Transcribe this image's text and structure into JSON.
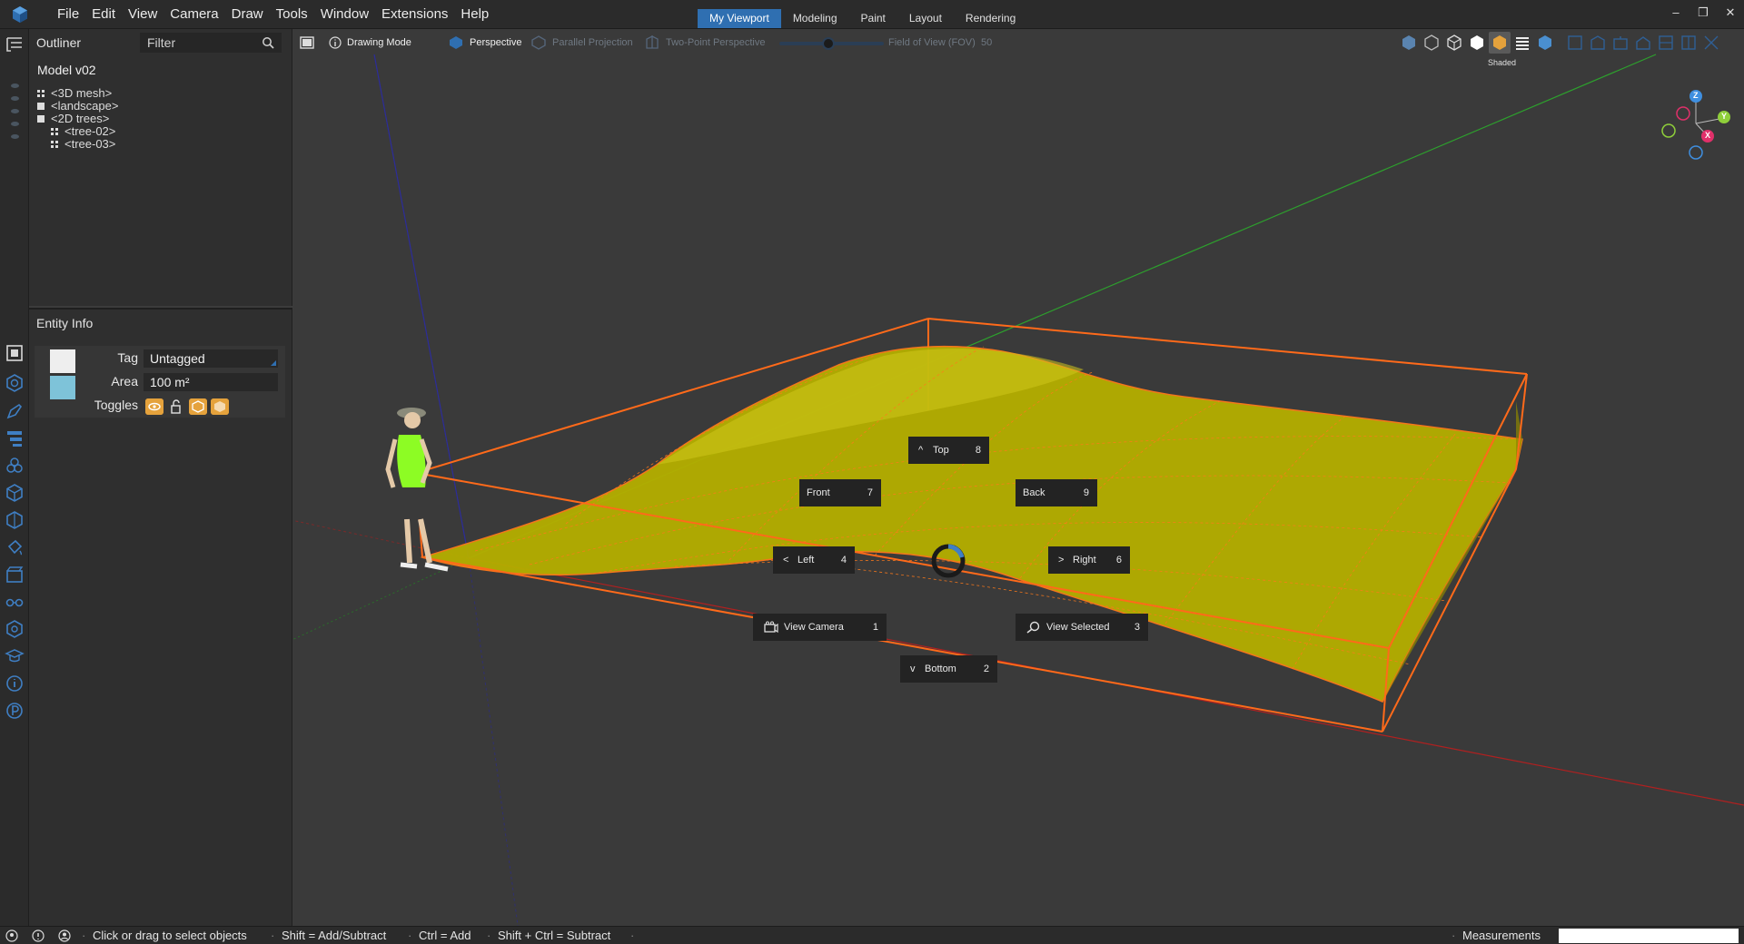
{
  "menubar": {
    "logo_icon": "app-cube-logo",
    "menus": [
      "File",
      "Edit",
      "View",
      "Camera",
      "Draw",
      "Tools",
      "Window",
      "Extensions",
      "Help"
    ],
    "mode_tabs": [
      {
        "label": "My Viewport",
        "active": true
      },
      {
        "label": "Modeling",
        "active": false
      },
      {
        "label": "Paint",
        "active": false
      },
      {
        "label": "Layout",
        "active": false
      },
      {
        "label": "Rendering",
        "active": false
      }
    ],
    "window_controls": [
      "minimize-icon",
      "restore-icon",
      "close-icon"
    ]
  },
  "outliner": {
    "title": "Outliner",
    "filter_placeholder": "Filter",
    "model_name": "Model v02",
    "items": [
      {
        "label": "<3D mesh>",
        "indent": 0,
        "icon": "component-icon"
      },
      {
        "label": "<landscape>",
        "indent": 0,
        "icon": "group-icon"
      },
      {
        "label": "<2D trees>",
        "indent": 0,
        "icon": "group-icon"
      },
      {
        "label": "<tree-02>",
        "indent": 1,
        "icon": "component-icon"
      },
      {
        "label": "<tree-03>",
        "indent": 1,
        "icon": "component-icon"
      }
    ]
  },
  "entity_info": {
    "title": "Entity Info",
    "tag_label": "Tag",
    "tag_value": "Untagged",
    "area_label": "Area",
    "area_value": "100 m²",
    "toggles_label": "Toggles",
    "toggles": [
      "visibility-icon",
      "lock-icon",
      "cast-shadow-icon",
      "receive-shadow-icon"
    ],
    "swatch_colors": [
      "#eeeeee",
      "#7ec3d9"
    ]
  },
  "viewport": {
    "drawing_mode_label": "Drawing Mode",
    "perspective_label": "Perspective",
    "parallel_label": "Parallel Projection",
    "two_point_label": "Two-Point Perspective",
    "fov_label": "Field of View (FOV)",
    "fov_value": "50",
    "style_tooltip": "Shaded",
    "style_icons": [
      "xray-icon",
      "back-edges-icon",
      "wireframe-icon",
      "hidden-line-icon",
      "shaded-icon",
      "shaded-textures-icon",
      "monochrome-icon"
    ],
    "view_icons": [
      "iso-view-icon",
      "top-view-icon",
      "front-view-icon",
      "right-view-icon",
      "back-view-icon",
      "left-view-icon",
      "bottom-view-icon"
    ],
    "nav": {
      "top": {
        "label": "Top",
        "key": "8",
        "glyph": "^"
      },
      "front": {
        "label": "Front",
        "key": "7"
      },
      "back": {
        "label": "Back",
        "key": "9"
      },
      "left": {
        "label": "Left",
        "key": "4",
        "glyph": "<"
      },
      "right": {
        "label": "Right",
        "key": "6",
        "glyph": ">"
      },
      "view_camera": {
        "label": "View Camera",
        "key": "1"
      },
      "view_selected": {
        "label": "View Selected",
        "key": "3"
      },
      "bottom": {
        "label": "Bottom",
        "key": "2",
        "glyph": "v"
      }
    },
    "axis_gizmo": {
      "z": "Z",
      "y": "Y",
      "x": "X"
    }
  },
  "statusbar": {
    "hint_1": "Click or drag to select objects",
    "hint_2": "Shift = Add/Subtract",
    "hint_3": "Ctrl = Add",
    "hint_4": "Shift + Ctrl = Subtract",
    "measurements_label": "Measurements",
    "measurements_value": ""
  },
  "colors": {
    "accent": "#2f6fb1",
    "selection": "#ff6a1a",
    "terrain": "#b5ae00",
    "toggle": "#e5a23c"
  }
}
